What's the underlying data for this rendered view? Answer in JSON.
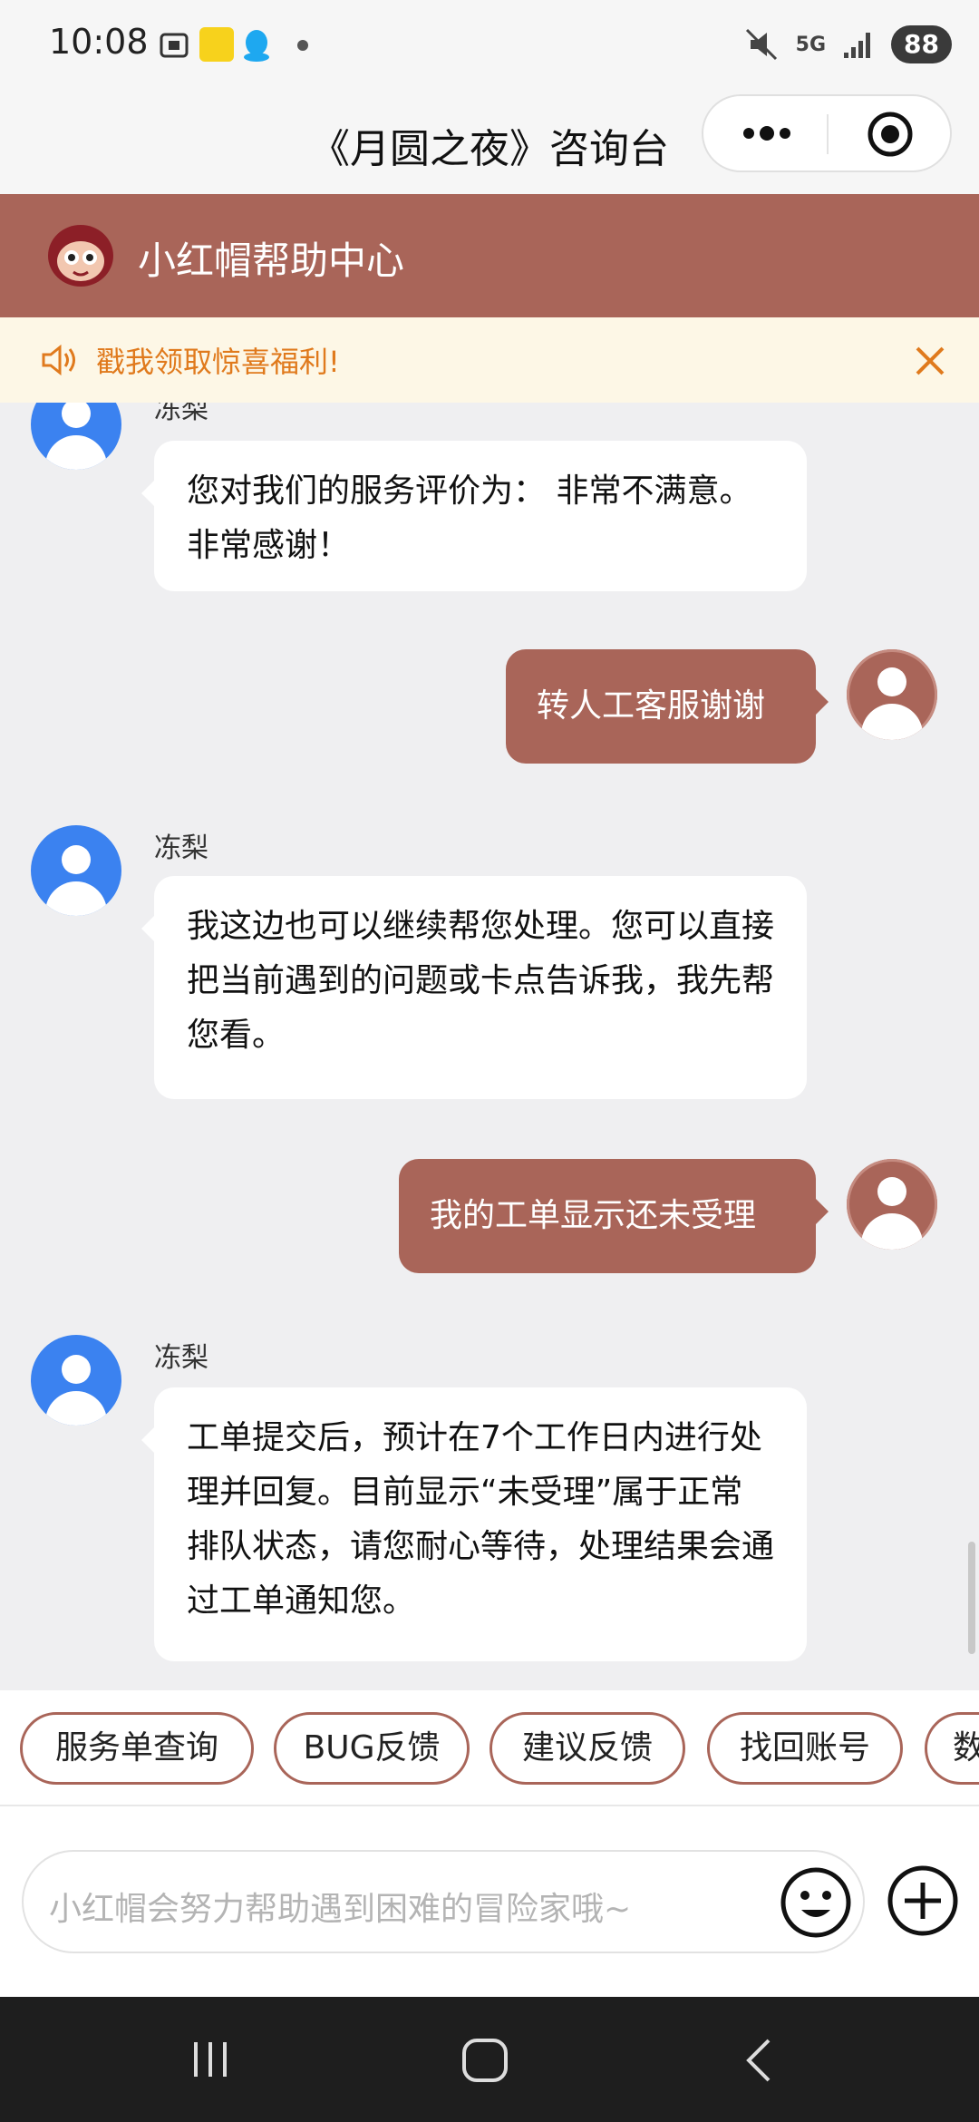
{
  "status_bar": {
    "time": "10:08",
    "network": "5G",
    "battery": "88"
  },
  "mini_program": {
    "title": "《月圆之夜》咨询台"
  },
  "help_center": {
    "title": "小红帽帮助中心"
  },
  "notice": {
    "text": "戳我领取惊喜福利!"
  },
  "messages": [
    {
      "from": "agent",
      "name": "冻梨",
      "text": "您对我们的服务评价为： 非常不满意。非常感谢！"
    },
    {
      "from": "user",
      "text": "转人工客服谢谢"
    },
    {
      "from": "agent",
      "name": "冻梨",
      "text": "我这边也可以继续帮您处理。您可以直接把当前遇到的问题或卡点告诉我，我先帮您看。"
    },
    {
      "from": "user",
      "text": "我的工单显示还未受理"
    },
    {
      "from": "agent",
      "name": "冻梨",
      "text": "工单提交后，预计在7个工作日内进行处理并回复。目前显示“未受理”属于正常排队状态，请您耐心等待，处理结果会通过工单通知您。"
    }
  ],
  "quick_actions": [
    "服务单查询",
    "BUG反馈",
    "建议反馈",
    "找回账号",
    "数"
  ],
  "input": {
    "placeholder": "小红帽会努力帮助遇到困难的冒险家哦~"
  },
  "colors": {
    "brand": "#a96559",
    "notice_bg": "#fdf7e6",
    "notice_text": "#e07a1d",
    "agent_avatar": "#3b82f0"
  },
  "icons": [
    "screenshot-icon",
    "app-badge-icon",
    "qq-icon",
    "mute-icon",
    "signal-icon",
    "more-icon",
    "close-miniprogram-icon",
    "mascot-logo",
    "speaker-icon",
    "close-icon",
    "emoji-icon",
    "plus-icon",
    "recent-apps-icon",
    "home-icon",
    "back-icon"
  ]
}
